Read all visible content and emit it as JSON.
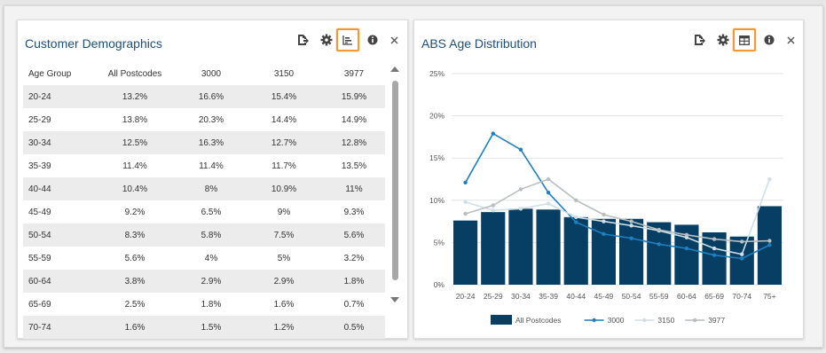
{
  "panel_left": {
    "title": "Customer Demographics",
    "columns": [
      "Age Group",
      "All Postcodes",
      "3000",
      "3150",
      "3977"
    ],
    "rows": [
      [
        "20-24",
        "13.2%",
        "16.6%",
        "15.4%",
        "15.9%"
      ],
      [
        "25-29",
        "13.8%",
        "20.3%",
        "14.4%",
        "14.9%"
      ],
      [
        "30-34",
        "12.5%",
        "16.3%",
        "12.7%",
        "12.8%"
      ],
      [
        "35-39",
        "11.4%",
        "11.4%",
        "11.7%",
        "13.5%"
      ],
      [
        "40-44",
        "10.4%",
        "8%",
        "10.9%",
        "11%"
      ],
      [
        "45-49",
        "9.2%",
        "6.5%",
        "9%",
        "9.3%"
      ],
      [
        "50-54",
        "8.3%",
        "5.8%",
        "7.5%",
        "5.6%"
      ],
      [
        "55-59",
        "5.6%",
        "4%",
        "5%",
        "3.2%"
      ],
      [
        "60-64",
        "3.8%",
        "2.9%",
        "2.9%",
        "1.8%"
      ],
      [
        "65-69",
        "2.5%",
        "1.8%",
        "1.6%",
        "0.7%"
      ],
      [
        "70-74",
        "1.6%",
        "1.5%",
        "1.2%",
        "0.5%"
      ]
    ],
    "tools": [
      "export-icon",
      "gear-icon",
      "chart-view-icon",
      "info-icon",
      "close-icon"
    ]
  },
  "panel_right": {
    "title": "ABS Age Distribution",
    "tools": [
      "export-icon",
      "gear-icon",
      "table-view-icon",
      "info-icon",
      "close-icon"
    ]
  },
  "colors": {
    "title": "#1e4f78",
    "bar": "#063f63",
    "series_3000": "#1f7fbf",
    "series_3150": "#cfdfe7",
    "series_3977": "#b8bec2",
    "highlight": "#f09a35"
  },
  "chart_data": {
    "type": "bar",
    "categories": [
      "20-24",
      "25-29",
      "30-34",
      "35-39",
      "40-44",
      "45-49",
      "50-54",
      "55-59",
      "60-64",
      "65-69",
      "70-74",
      "75+"
    ],
    "yticks": [
      "0%",
      "5%",
      "10%",
      "15%",
      "20%",
      "25%"
    ],
    "ylim": [
      0,
      25
    ],
    "grid": true,
    "legend_position": "bottom",
    "series": [
      {
        "name": "All Postcodes",
        "kind": "bar",
        "values": [
          7.6,
          8.6,
          9.0,
          8.9,
          8.0,
          7.8,
          7.8,
          7.4,
          7.1,
          6.2,
          5.7,
          9.3
        ]
      },
      {
        "name": "3000",
        "kind": "line",
        "values": [
          12.1,
          17.9,
          16.0,
          10.9,
          7.4,
          6.0,
          5.5,
          4.8,
          4.3,
          3.5,
          3.1,
          4.7
        ]
      },
      {
        "name": "3150",
        "kind": "line",
        "values": [
          9.8,
          8.8,
          9.0,
          9.6,
          8.0,
          7.5,
          7.0,
          6.4,
          5.6,
          4.3,
          3.6,
          12.5
        ]
      },
      {
        "name": "3977",
        "kind": "line",
        "values": [
          8.4,
          9.4,
          11.3,
          12.5,
          10.0,
          8.3,
          7.5,
          6.5,
          5.9,
          5.4,
          5.1,
          5.2
        ]
      }
    ]
  }
}
